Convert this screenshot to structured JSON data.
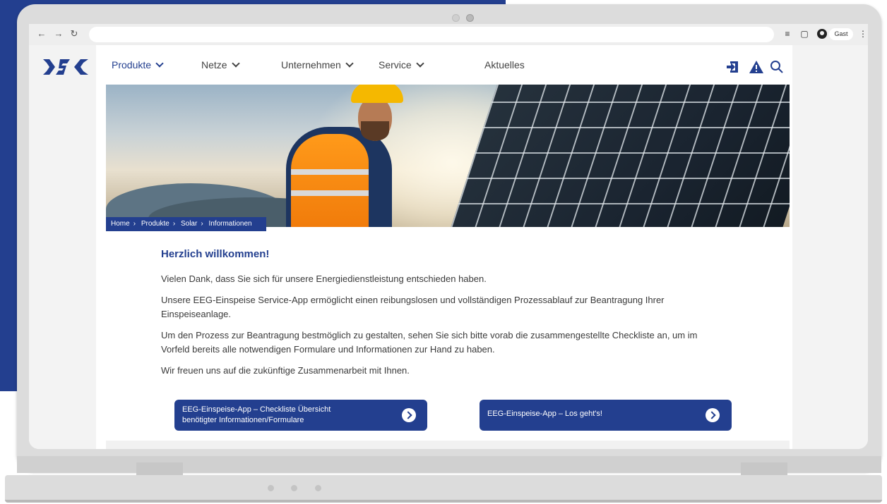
{
  "browser": {
    "profile_label": "Gast",
    "nav_icons": [
      "back-arrow-icon",
      "forward-arrow-icon",
      "reload-icon"
    ],
    "toolbar_icons": [
      "reading-list-icon",
      "side-panel-icon",
      "profile-icon",
      "kebab-menu-icon"
    ]
  },
  "site": {
    "logo_text": "DSC",
    "nav": [
      {
        "label": "Produkte",
        "dropdown": true,
        "active": true
      },
      {
        "label": "Netze",
        "dropdown": true
      },
      {
        "label": "Unternehmen",
        "dropdown": true
      },
      {
        "label": "Service",
        "dropdown": true
      },
      {
        "label": "Aktuelles",
        "dropdown": false
      }
    ],
    "header_icons": [
      "login-icon",
      "warning-icon",
      "search-icon"
    ],
    "colors": {
      "brand": "#233f8f",
      "background": "#233f8f"
    }
  },
  "hero": {
    "breadcrumb": [
      "Home",
      "Produkte",
      "Solar",
      "Informationen"
    ]
  },
  "content": {
    "title": "Herzlich willkommen!",
    "paragraphs": [
      "Vielen Dank, dass Sie sich für unsere Energiedienstleistung entschieden haben.",
      "Unsere EEG-Einspeise Service-App ermöglicht einen reibungslosen und vollständigen Prozessablauf zur Beantragung Ihrer Einspeiseanlage.",
      "Um den Prozess zur Beantragung bestmöglich zu gestalten, sehen Sie sich bitte vorab die zusammengestellte Checkliste an, um im Vorfeld bereits alle notwendigen Formulare und Informationen zur Hand zu haben.",
      "Wir freuen uns auf die zukünftige Zusammenarbeit mit Ihnen."
    ],
    "buttons": [
      {
        "label": "EEG-Einspeise-App – Checkliste Übersicht benötigter Informationen/Formulare"
      },
      {
        "label": "EEG-Einspeise-App – Los geht's!"
      }
    ]
  }
}
